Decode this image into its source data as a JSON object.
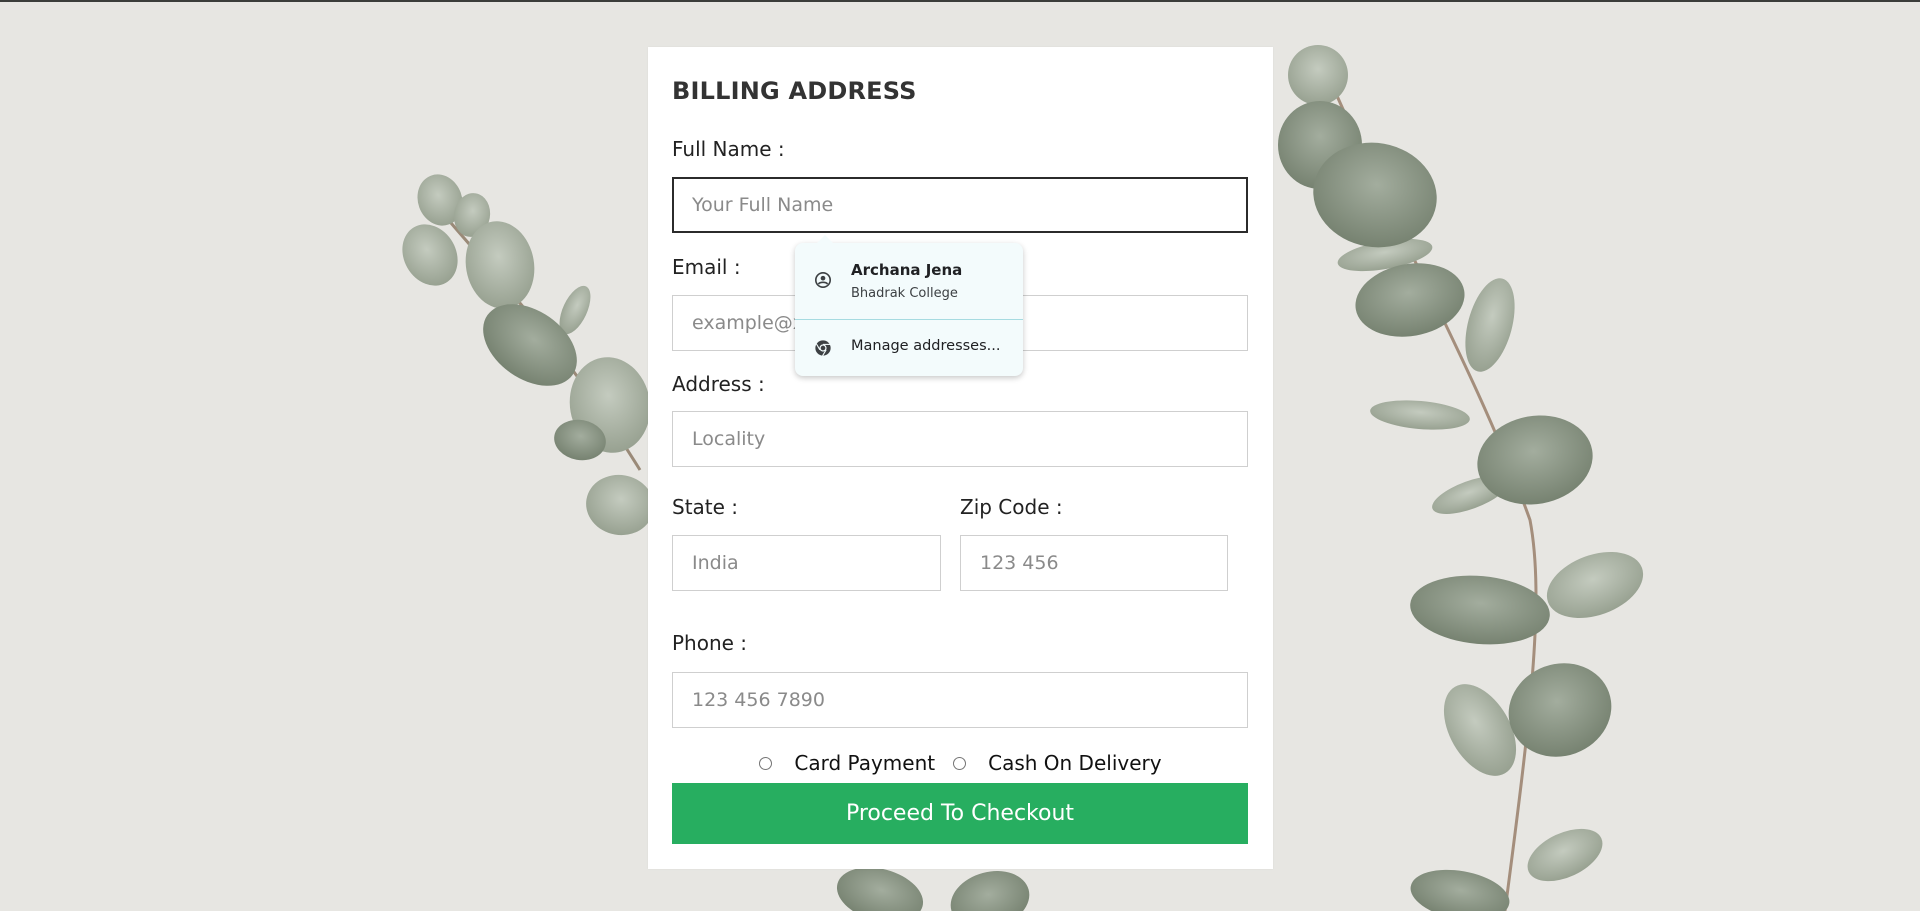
{
  "form": {
    "title": "BILLING ADDRESS",
    "full_name": {
      "label": "Full Name :",
      "placeholder": "Your Full Name",
      "value": ""
    },
    "email": {
      "label": "Email :",
      "placeholder": "example@xyz.com",
      "value": ""
    },
    "address": {
      "label": "Address :",
      "placeholder": "Locality",
      "value": ""
    },
    "state": {
      "label": "State :",
      "placeholder": "India",
      "value": ""
    },
    "zip": {
      "label": "Zip Code :",
      "placeholder": "123 456",
      "value": ""
    },
    "phone": {
      "label": "Phone :",
      "placeholder": "123 456 7890",
      "value": ""
    },
    "payment_options": [
      "Card Payment",
      "Cash On Delivery"
    ],
    "submit_label": "Proceed To Checkout"
  },
  "autofill": {
    "profile_name": "Archana Jena",
    "profile_detail": "Bhadrak College",
    "manage_label": "Manage addresses...",
    "profile_icon": "account-circle-icon",
    "manage_icon": "chrome-icon"
  },
  "colors": {
    "accent": "#27ae60",
    "page_background": "#e7e6e2",
    "card_background": "#ffffff",
    "popup_background": "#f3fbfc"
  }
}
